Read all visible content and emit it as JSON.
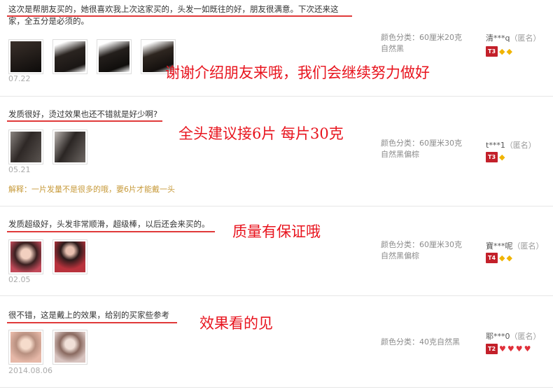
{
  "reviews": [
    {
      "text": "这次是帮朋友买的，她很喜欢我上次这家买的，头发一如既往的好，朋友很满意。下次还来这家，全五分是必须的。",
      "line1": "这次是帮朋友买的，她很喜欢我上次这家买的，头发一如既往的好，朋友很满意。下次还来这",
      "line2": "家，全五分是必须的。",
      "date": "07.22",
      "sku_color": "颜色分类：60厘米20克",
      "sku_shade": "自然黑",
      "user": "清***q",
      "anon": "（匿名）",
      "level": "T3",
      "gem_type": "diamond",
      "gem_count": 2,
      "annotation": "谢谢介绍朋友来哦，我们会继续努力做好",
      "thumb_colors": [
        "#1c1a18",
        "#2a2420",
        "#241f1c",
        "#2e2620"
      ]
    },
    {
      "text": "发质很好，烫过效果也还不错就是好少啊?",
      "date": "05.21",
      "sku_color": "颜色分类：60厘米30克",
      "sku_shade": "自然黑偏棕",
      "user": "t***1",
      "anon": "（匿名）",
      "level": "T3",
      "gem_type": "diamond",
      "gem_count": 1,
      "annotation": "全头建议接6片  每片30克",
      "reply": "解释：一片发量不是很多的哦，要6片才能戴一头",
      "thumb_colors": [
        "#3a3330",
        "#2b2624"
      ]
    },
    {
      "text": "发质超级好，头发非常顺滑，超级棒，以后还会来买的。",
      "date": "02.05",
      "sku_color": "颜色分类：60厘米30克",
      "sku_shade": "自然黑偏棕",
      "user": "寶***呢",
      "anon": "（匿名）",
      "level": "T4",
      "gem_type": "diamond",
      "gem_count": 2,
      "annotation": "质量有保证哦",
      "thumb_colors": [
        "#c24a5a",
        "#b8323c"
      ]
    },
    {
      "text": "很不错，这是戴上的效果，给别的买家些参考",
      "date": "2014.08.06",
      "sku_color": "颜色分类：40克自然黑",
      "user": "耶***0",
      "anon": "（匿名）",
      "level": "T2",
      "gem_type": "heart",
      "gem_count": 4,
      "annotation": "效果看的见",
      "thumb_colors": [
        "#e6b8a8",
        "#d8c4c0"
      ]
    }
  ],
  "colors": {
    "annotation": "#e8141e",
    "underline": "#e03a3a",
    "level_badge": "#c3202a",
    "diamond": "#f0b400",
    "heart": "#e0303a"
  }
}
